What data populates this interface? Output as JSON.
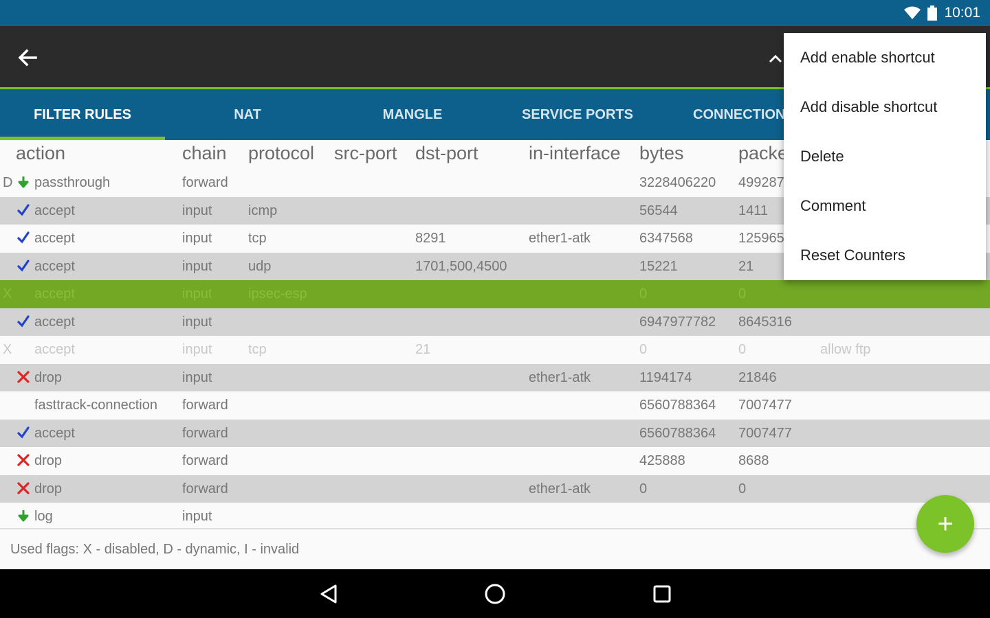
{
  "status": {
    "time": "10:01",
    "icons": [
      "wifi-icon",
      "battery-icon"
    ]
  },
  "toolbar": {
    "back_icon": "arrow-back-icon",
    "collapse_icon": "chevron-up-icon"
  },
  "tabs": [
    {
      "label": "FILTER RULES",
      "active": true
    },
    {
      "label": "NAT"
    },
    {
      "label": "MANGLE"
    },
    {
      "label": "SERVICE PORTS"
    },
    {
      "label": "CONNECTION"
    }
  ],
  "table": {
    "columns": [
      "action",
      "chain",
      "protocol",
      "src-port",
      "dst-port",
      "in-interface",
      "bytes",
      "packe"
    ],
    "rows": [
      {
        "flag": "D",
        "icon": "passthrough",
        "action": "passthrough",
        "chain": "forward",
        "protocol": "",
        "dst_port": "",
        "in_interface": "",
        "bytes": "3228406220",
        "packets": "499287",
        "comment": "",
        "style": "white"
      },
      {
        "flag": "",
        "icon": "accept",
        "action": "accept",
        "chain": "input",
        "protocol": "icmp",
        "dst_port": "",
        "in_interface": "",
        "bytes": "56544",
        "packets": "1411",
        "comment": "",
        "style": "gray"
      },
      {
        "flag": "",
        "icon": "accept",
        "action": "accept",
        "chain": "input",
        "protocol": "tcp",
        "dst_port": "8291",
        "in_interface": "ether1-atk",
        "bytes": "6347568",
        "packets": "125965",
        "comment": "",
        "style": "white"
      },
      {
        "flag": "",
        "icon": "accept",
        "action": "accept",
        "chain": "input",
        "protocol": "udp",
        "dst_port": "1701,500,4500",
        "in_interface": "",
        "bytes": "15221",
        "packets": "21",
        "comment": "",
        "style": "gray"
      },
      {
        "flag": "X",
        "icon": "",
        "action": "accept",
        "chain": "input",
        "protocol": "ipsec-esp",
        "dst_port": "",
        "in_interface": "",
        "bytes": "0",
        "packets": "0",
        "comment": "",
        "style": "selected"
      },
      {
        "flag": "",
        "icon": "accept",
        "action": "accept",
        "chain": "input",
        "protocol": "",
        "dst_port": "",
        "in_interface": "",
        "bytes": "6947977782",
        "packets": "8645316",
        "comment": "",
        "style": "gray"
      },
      {
        "flag": "X",
        "icon": "",
        "action": "accept",
        "chain": "input",
        "protocol": "tcp",
        "dst_port": "21",
        "in_interface": "",
        "bytes": "0",
        "packets": "0",
        "comment": "allow ftp",
        "style": "disabled"
      },
      {
        "flag": "",
        "icon": "drop",
        "action": "drop",
        "chain": "input",
        "protocol": "",
        "dst_port": "",
        "in_interface": "ether1-atk",
        "bytes": "1194174",
        "packets": "21846",
        "comment": "",
        "style": "gray"
      },
      {
        "flag": "",
        "icon": "",
        "action": "fasttrack-connection",
        "chain": "forward",
        "protocol": "",
        "dst_port": "",
        "in_interface": "",
        "bytes": "6560788364",
        "packets": "7007477",
        "comment": "",
        "style": "white"
      },
      {
        "flag": "",
        "icon": "accept",
        "action": "accept",
        "chain": "forward",
        "protocol": "",
        "dst_port": "",
        "in_interface": "",
        "bytes": "6560788364",
        "packets": "7007477",
        "comment": "",
        "style": "gray"
      },
      {
        "flag": "",
        "icon": "drop",
        "action": "drop",
        "chain": "forward",
        "protocol": "",
        "dst_port": "",
        "in_interface": "",
        "bytes": "425888",
        "packets": "8688",
        "comment": "",
        "style": "white"
      },
      {
        "flag": "",
        "icon": "drop",
        "action": "drop",
        "chain": "forward",
        "protocol": "",
        "dst_port": "",
        "in_interface": "ether1-atk",
        "bytes": "0",
        "packets": "0",
        "comment": "",
        "style": "gray"
      },
      {
        "flag": "",
        "icon": "passthrough",
        "action": "log",
        "chain": "input",
        "protocol": "",
        "dst_port": "",
        "in_interface": "",
        "bytes": "",
        "packets": "",
        "comment": "",
        "style": "white"
      }
    ]
  },
  "footer": {
    "flags_text": "Used flags: X - disabled, D - dynamic, I - invalid"
  },
  "fab": {
    "label": "+"
  },
  "menu": {
    "items": [
      "Add enable shortcut",
      "Add disable shortcut",
      "Delete",
      "Comment",
      "Reset Counters"
    ]
  },
  "navbar": {
    "icons": [
      "back-nav-icon",
      "home-nav-icon",
      "recents-nav-icon"
    ]
  },
  "colors": {
    "statusbar": "#0d5f8c",
    "toolbar": "#2b2b2b",
    "accent": "#7cc32a",
    "selected_row": "#72a824"
  }
}
